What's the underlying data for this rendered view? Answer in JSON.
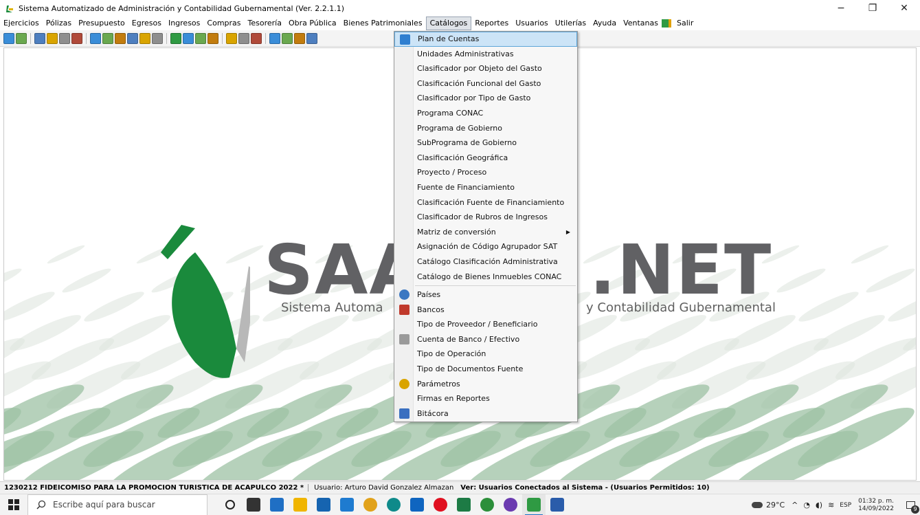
{
  "window": {
    "title": "Sistema Automatizado de Administración y Contabilidad Gubernamental  (Ver. 2.2.1.1)",
    "controls": [
      "−",
      "❐",
      "✕"
    ]
  },
  "menubar": [
    "Ejercicios",
    "Pólizas",
    "Presupuesto",
    "Egresos",
    "Ingresos",
    "Compras",
    "Tesorería",
    "Obra Pública",
    "Bienes Patrimoniales",
    "Catálogos",
    "Reportes",
    "Usuarios",
    "Utilerías",
    "Ayuda",
    "Ventanas",
    "Salir"
  ],
  "active_menu": "Catálogos",
  "toolbar_icons": [
    "refresh-icon",
    "document-icon",
    "|",
    "printer-icon",
    "folder-icon",
    "notepad-icon",
    "table-icon",
    "|",
    "c-icon",
    "d-icon",
    "e-icon",
    "f-icon",
    "p-icon",
    "print-icon",
    "|",
    "clipboard-icon",
    "pencil-icon",
    "bucket-icon",
    "box-icon",
    "|",
    "notebook-icon",
    "tools-icon",
    "hand-icon",
    "|",
    "tree-icon",
    "sun-icon",
    "calendar-icon",
    "help-icon"
  ],
  "background_logo": {
    "brand": "SAA",
    "brand_end": ".NET",
    "subtitle_left": "Sistema Automa",
    "subtitle_right": "y Contabilidad Gubernamental",
    "colors": {
      "gray": "#616164",
      "green": "#1a8a3c"
    }
  },
  "catalog_menu": {
    "items": [
      {
        "label": "Plan de Cuentas",
        "icon": "tree-icon",
        "selected": true
      },
      {
        "label": "Unidades Administrativas"
      },
      {
        "label": "Clasificador por Objeto del Gasto"
      },
      {
        "label": "Clasificación Funcional del Gasto"
      },
      {
        "label": "Clasificador por Tipo de Gasto"
      },
      {
        "label": "Programa CONAC"
      },
      {
        "label": "Programa de Gobierno"
      },
      {
        "label": "SubPrograma de Gobierno"
      },
      {
        "label": "Clasificación Geográfica"
      },
      {
        "label": "Proyecto / Proceso"
      },
      {
        "label": "Fuente de Financiamiento"
      },
      {
        "label": "Clasificación Fuente de Financiamiento"
      },
      {
        "label": "Clasificador de Rubros de Ingresos"
      },
      {
        "label": "Matriz de conversión",
        "submenu": true
      },
      {
        "label": "Asignación de Código Agrupador SAT"
      },
      {
        "label": "Catálogo Clasificación Administrativa"
      },
      {
        "label": "Catálogo de Bienes Inmuebles CONAC"
      },
      {
        "separator": true
      },
      {
        "label": "Países",
        "icon": "globe-icon"
      },
      {
        "label": "Bancos",
        "icon": "bank-icon"
      },
      {
        "label": "Tipo de Proveedor / Beneficiario"
      },
      {
        "label": "Cuenta de Banco / Efectivo",
        "icon": "account-icon"
      },
      {
        "label": "Tipo de Operación"
      },
      {
        "label": "Tipo de Documentos Fuente"
      },
      {
        "label": "Parámetros",
        "icon": "gear-icon"
      },
      {
        "label": "Firmas en Reportes"
      },
      {
        "label": "Bitácora",
        "icon": "log-icon"
      }
    ]
  },
  "statusbar": {
    "entity": "1230212 FIDEICOMISO PARA LA PROMOCION TURISTICA DE ACAPULCO  2022  *",
    "user": "Usuario: Arturo David Gonzalez Almazan",
    "connected": "Ver: Usuarios Conectados al Sistema - (Usuarios Permitidos: 10)"
  },
  "taskbar": {
    "search_placeholder": "Escribe aquí para buscar",
    "apps": [
      {
        "name": "cortana-icon",
        "color": "#222222"
      },
      {
        "name": "task-view-icon",
        "color": "#333333"
      },
      {
        "name": "mail-icon",
        "color": "#1f6fc4"
      },
      {
        "name": "file-explorer-icon",
        "color": "#f0b500"
      },
      {
        "name": "store-icon",
        "color": "#1664b0"
      },
      {
        "name": "edge-legacy-icon",
        "color": "#1e7bd0"
      },
      {
        "name": "chrome-icon",
        "color": "#e1a21b"
      },
      {
        "name": "edge-icon",
        "color": "#0f8a8a"
      },
      {
        "name": "outlook-icon",
        "color": "#0f65c0"
      },
      {
        "name": "opera-icon",
        "color": "#e01020"
      },
      {
        "name": "excel-icon",
        "color": "#1d7b45"
      },
      {
        "name": "chrome-profile-icon",
        "color": "#2c8f3a"
      },
      {
        "name": "firefox-icon",
        "color": "#6b3bb0"
      },
      {
        "name": "saacg-icon",
        "color": "#2f9a43"
      },
      {
        "name": "word-icon",
        "color": "#2a5caa"
      }
    ],
    "weather": "29°C",
    "language": "ESP",
    "time": "01:32 p. m.",
    "date": "14/09/2022",
    "notifications": "9"
  }
}
